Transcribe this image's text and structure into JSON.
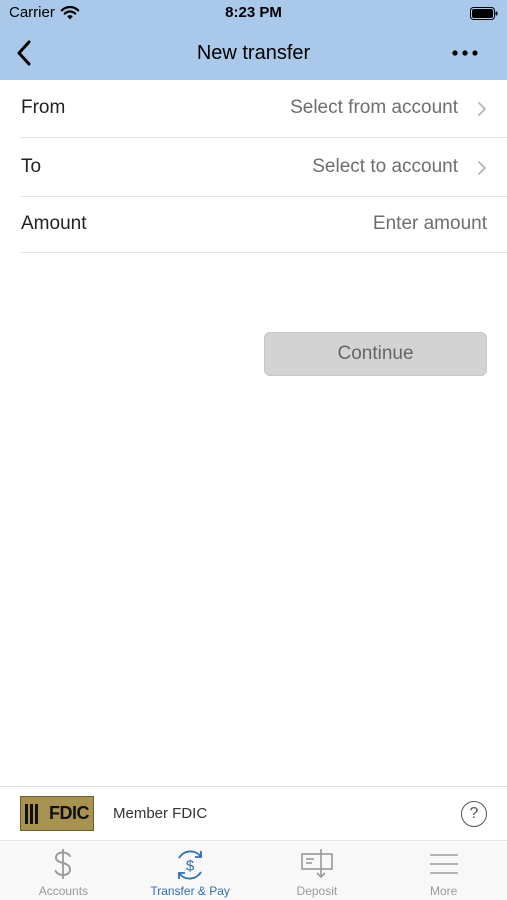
{
  "status_bar": {
    "carrier": "Carrier",
    "time": "8:23 PM"
  },
  "nav": {
    "title": "New transfer"
  },
  "form": {
    "from": {
      "label": "From",
      "value": "Select from account"
    },
    "to": {
      "label": "To",
      "value": "Select to account"
    },
    "amount": {
      "label": "Amount",
      "placeholder": "Enter amount"
    },
    "continue_label": "Continue"
  },
  "fdic": {
    "logo_text": "FDIC",
    "text": "Member FDIC",
    "help_icon_text": "?"
  },
  "tabs": [
    {
      "label": "Accounts",
      "icon": "dollar-icon",
      "active": false
    },
    {
      "label": "Transfer & Pay",
      "icon": "transfer-dollar-icon",
      "active": true
    },
    {
      "label": "Deposit",
      "icon": "check-deposit-icon",
      "active": false
    },
    {
      "label": "More",
      "icon": "hamburger-icon",
      "active": false
    }
  ],
  "colors": {
    "header_bg": "#a9c8ea",
    "active_tab": "#2f6db3",
    "inactive_tab": "#9a9a9a",
    "button_bg": "#d3d3d3"
  }
}
